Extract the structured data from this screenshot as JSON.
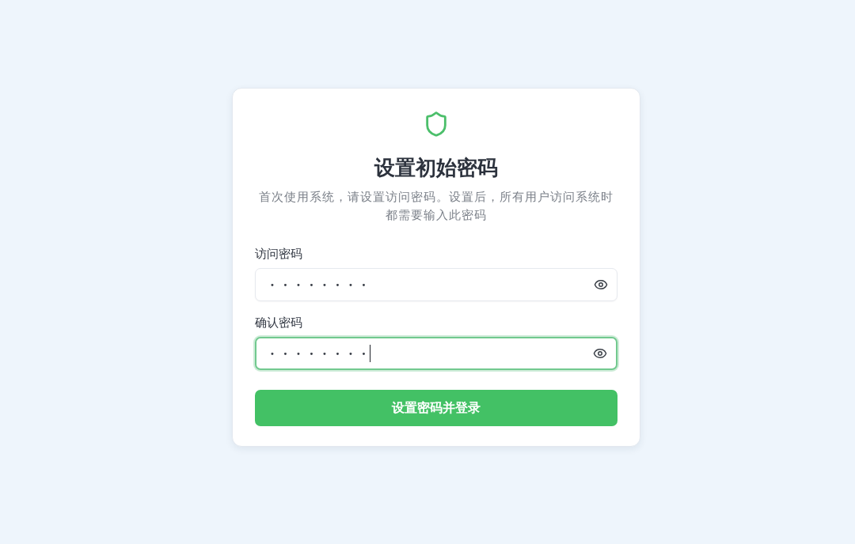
{
  "header": {
    "title": "设置初始密码",
    "description": "首次使用系统，请设置访问密码。设置后，所有用户访问系统时都需要输入此密码"
  },
  "fields": [
    {
      "label": "访问密码",
      "value": "••••••••",
      "focused": false
    },
    {
      "label": "确认密码",
      "value": "••••••••",
      "focused": true
    }
  ],
  "submit_button": {
    "label": "设置密码并登录"
  }
}
